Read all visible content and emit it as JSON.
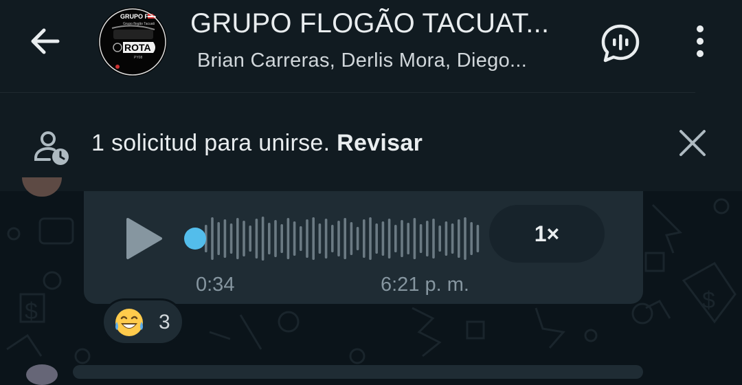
{
  "header": {
    "title": "GRUPO FLOGÃO TACUAT...",
    "subtitle": "Brian Carreras, Derlis Mora, Diego...",
    "avatar_text": {
      "top": "GRUPO F.T",
      "line2": "Grupo flogão Tacuati",
      "main": "ROTA",
      "sub": "PY08"
    },
    "icons": {
      "back": "arrow-left-icon",
      "voice_chat": "voice-chat-icon",
      "menu": "more-vertical-icon"
    }
  },
  "notice": {
    "text": "1 solicitud para unirse.",
    "link": "Revisar",
    "icons": {
      "left": "pending-user-icon",
      "close": "close-icon"
    }
  },
  "message": {
    "type": "voice",
    "duration": "0:34",
    "time": "6:21 p. m.",
    "speed": "1×",
    "progress": 0,
    "accent_color": "#53bdeb"
  },
  "reaction": {
    "emoji": "😂",
    "count": "3"
  }
}
